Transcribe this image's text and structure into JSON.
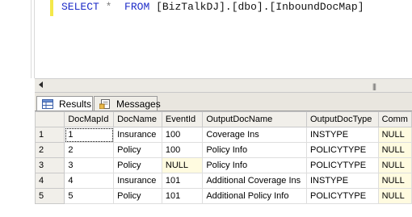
{
  "editor": {
    "query": {
      "select": "SELECT",
      "star": "*",
      "from": "FROM",
      "object": "[BizTalkDJ].[dbo].[InboundDocMap]"
    }
  },
  "tabs": [
    {
      "label": "Results"
    },
    {
      "label": "Messages"
    }
  ],
  "grid": {
    "columns": [
      "DocMapId",
      "DocName",
      "EventId",
      "OutputDocName",
      "OutputDocType",
      "Comm"
    ],
    "rows": [
      {
        "num": "1",
        "cells": [
          "1",
          "Insurance",
          "100",
          "Coverage Ins",
          "INSTYPE",
          "NULL"
        ]
      },
      {
        "num": "2",
        "cells": [
          "2",
          "Policy",
          "100",
          "Policy Info",
          "POLICYTYPE",
          "NULL"
        ]
      },
      {
        "num": "3",
        "cells": [
          "3",
          "Policy",
          "NULL",
          "Policy Info",
          "POLICYTYPE",
          "NULL"
        ]
      },
      {
        "num": "4",
        "cells": [
          "4",
          "Insurance",
          "101",
          "Additional Coverage Ins",
          "INSTYPE",
          "NULL"
        ]
      },
      {
        "num": "5",
        "cells": [
          "5",
          "Policy",
          "101",
          "Additional Policy Info",
          "POLICYTYPE",
          "NULL"
        ]
      }
    ],
    "null_value": "NULL"
  },
  "colors": {
    "keyword": "#1d2bc8",
    "null_cell": "#fffbe0",
    "change_bar": "#f4e84a"
  }
}
